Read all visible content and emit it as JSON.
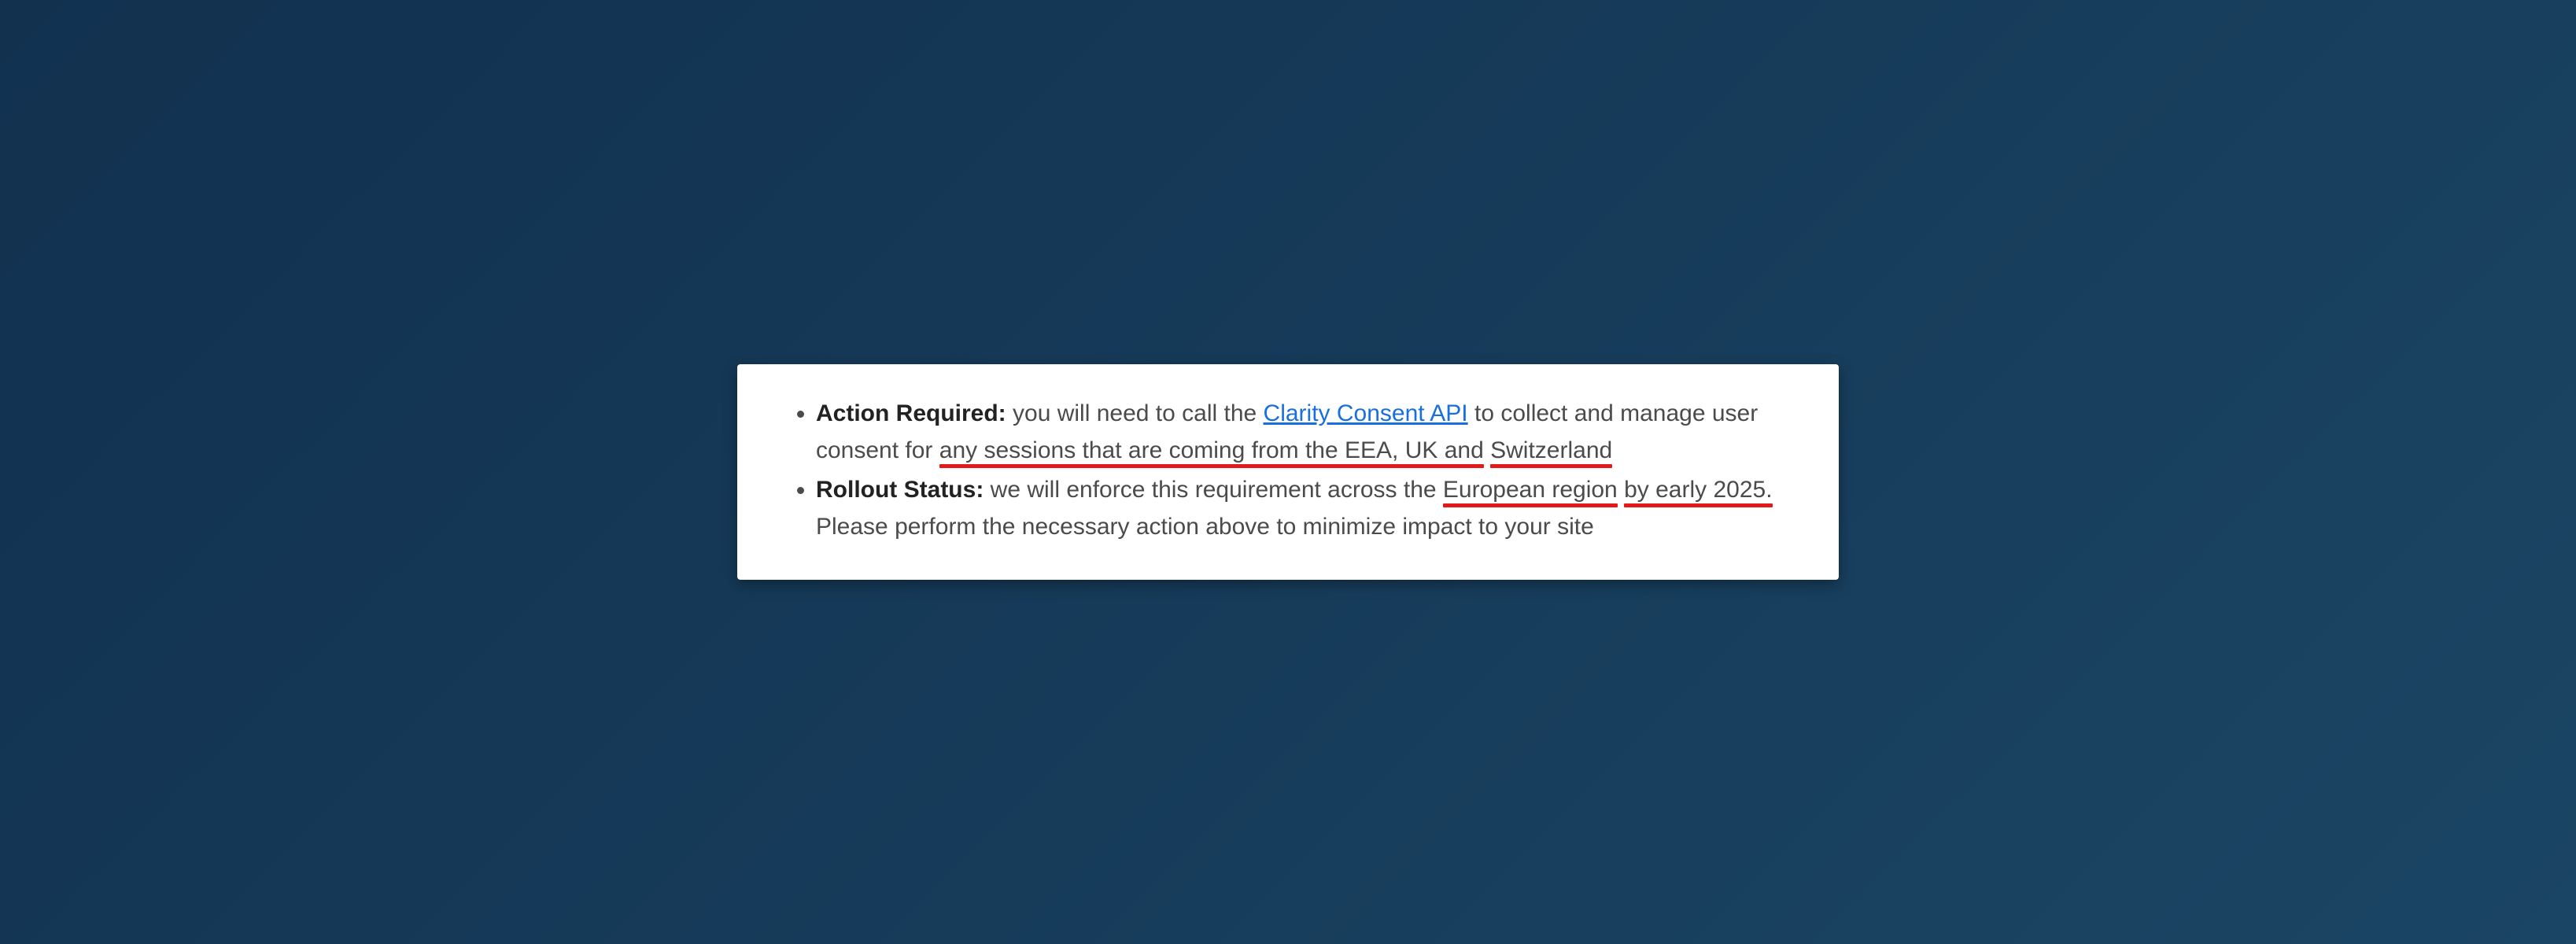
{
  "items": [
    {
      "label": "Action Required:",
      "segments": [
        {
          "type": "text",
          "value": " you will need to call the "
        },
        {
          "type": "link",
          "value": "Clarity Consent API"
        },
        {
          "type": "text",
          "value": " to collect and manage user consent for "
        },
        {
          "type": "annot",
          "value": "any sessions that are coming from the EEA, UK and"
        },
        {
          "type": "text",
          "value": " "
        },
        {
          "type": "annot",
          "value": "Switzerland"
        }
      ]
    },
    {
      "label": "Rollout Status:",
      "segments": [
        {
          "type": "text",
          "value": " we will enforce this requirement across the "
        },
        {
          "type": "annot",
          "value": "European region"
        },
        {
          "type": "text",
          "value": " "
        },
        {
          "type": "annot",
          "value": "by early 2025."
        },
        {
          "type": "text",
          "value": " Please perform the necessary action above to minimize impact to your site"
        }
      ]
    }
  ]
}
